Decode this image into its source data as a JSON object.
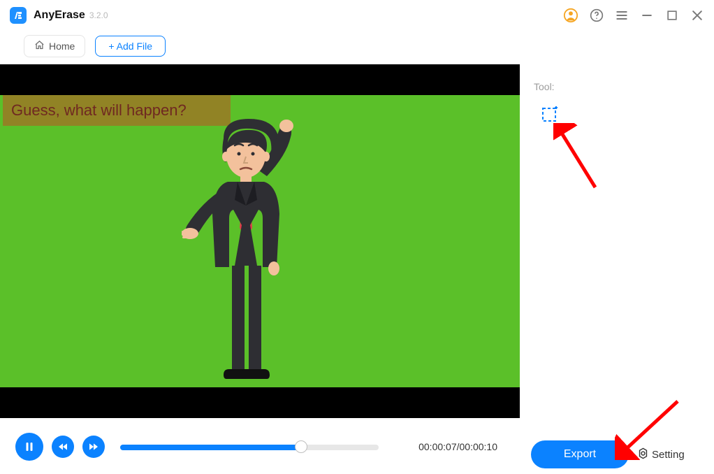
{
  "app": {
    "name": "AnyErase",
    "version": "3.2.0"
  },
  "toolbar": {
    "home_label": "Home",
    "addfile_label": "+ Add File"
  },
  "video": {
    "caption_text": "Guess, what will happen?",
    "time_display": "00:00:07/00:00:10",
    "progress_percent": 70
  },
  "right_panel": {
    "tool_label": "Tool:"
  },
  "actions": {
    "export_label": "Export",
    "setting_label": "Setting"
  },
  "icons": {
    "user": "user-icon",
    "help": "help-icon",
    "hamburger": "hamburger-icon",
    "minimize": "minimize-icon",
    "maximize": "maximize-icon",
    "close": "close-icon",
    "home": "home-icon",
    "pause": "pause-icon",
    "rewind": "rewind-icon",
    "forward": "forward-icon",
    "marquee": "marquee-select-icon",
    "gear": "gear-icon"
  },
  "colors": {
    "accent": "#0b82ff",
    "user_accent": "#f6a623",
    "video_bg": "#5bc029",
    "caption_bg": "#918325",
    "caption_text": "#6f2821"
  }
}
